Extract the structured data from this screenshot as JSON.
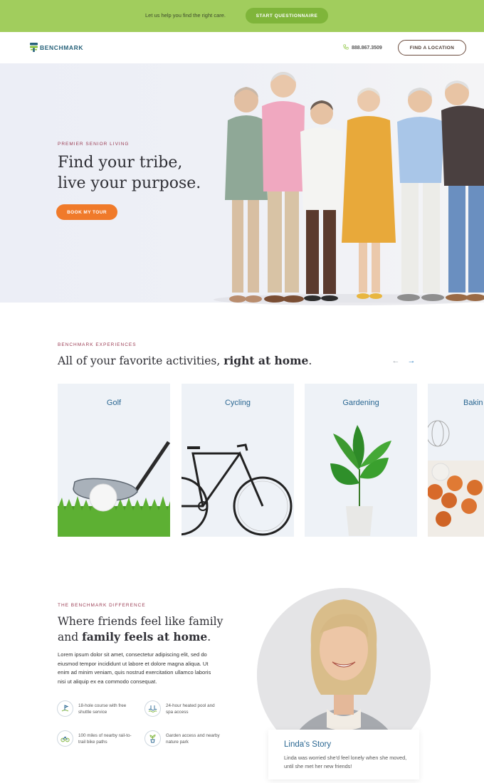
{
  "banner": {
    "message": "Let us help you find the right care.",
    "cta_label": "START QUESTIONNAIRE"
  },
  "header": {
    "logo_text": "BENCHMARK",
    "phone": "888.867.3509",
    "find_location_label": "FIND A LOCATION"
  },
  "hero": {
    "eyebrow": "PREMIER SENIOR LIVING",
    "title_line1": "Find your tribe,",
    "title_line2": "live your purpose.",
    "button_label": "BOOK MY TOUR"
  },
  "experiences": {
    "eyebrow": "BENCHMARK EXPERIENCES",
    "title_regular": "All of your favorite activities, ",
    "title_bold": "right at home",
    "title_end": ".",
    "prev_icon": "arrow-left-icon",
    "next_icon": "arrow-right-icon",
    "cards": [
      {
        "label": "Golf"
      },
      {
        "label": "Cycling"
      },
      {
        "label": "Gardening"
      },
      {
        "label": "Bakin"
      }
    ]
  },
  "difference": {
    "eyebrow": "THE BENCHMARK DIFFERENCE",
    "title_line1": "Where friends feel like family",
    "title_line2_regular": "and ",
    "title_line2_bold": "family feels at home",
    "title_line2_end": ".",
    "body": "Lorem ipsum dolor sit amet, consectetur adipiscing elit, sed do eiusmod tempor incididunt ut labore et dolore magna aliqua. Ut enim ad minim veniam, quis nostrud exercitation ullamco laboris nisi ut aliquip ex ea commodo consequat.",
    "features": [
      {
        "text": "18-hole course with free shuttle service",
        "icon": "golf-icon"
      },
      {
        "text": "24-hour heated pool and spa access",
        "icon": "pool-icon"
      },
      {
        "text": "100 miles of nearby rail-to-trail bike paths",
        "icon": "bike-icon"
      },
      {
        "text": "Garden access and nearby nature park",
        "icon": "plant-icon"
      }
    ]
  },
  "story": {
    "title": "Linda's Story",
    "description": "Linda was worried she'd feel lonely when she moved, until she met her new friends!"
  },
  "colors": {
    "banner_bg": "#a1cd5d",
    "accent_orange": "#f07a2a",
    "eyebrow": "#9a3b52",
    "link_blue": "#2a6792"
  }
}
